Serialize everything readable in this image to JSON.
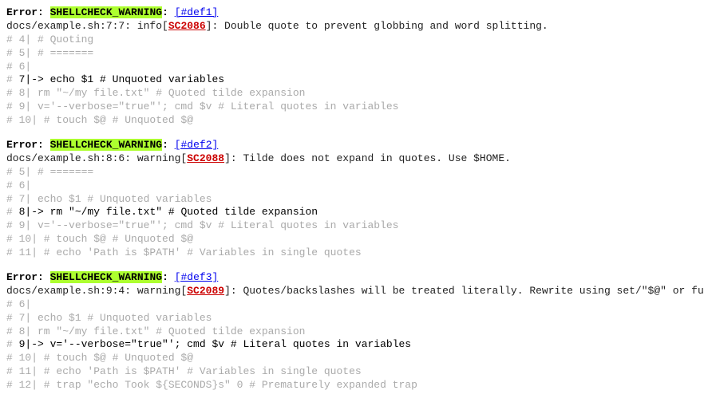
{
  "errors": [
    {
      "label": "Error:",
      "warn": "SHELLCHECK_WARNING",
      "anchor": "[#def1]",
      "loc_prefix": "docs/example.sh:7:7: info[",
      "sc": "SC2086",
      "loc_suffix": "]: Double quote to prevent globbing and word splitting.",
      "lines": [
        {
          "pre": "#    4|   # Quoting",
          "highlight": false
        },
        {
          "pre": "#    5|   # =======",
          "highlight": false
        },
        {
          "pre": "#    6|",
          "highlight": false
        },
        {
          "pre": "#    7|->  echo $1                          # Unquoted variables",
          "highlight": true
        },
        {
          "pre": "#    8|    rm \"~/my file.txt\"               # Quoted tilde expansion",
          "highlight": false
        },
        {
          "pre": "#    9|    v='--verbose=\"true\"'; cmd $v     # Literal quotes in variables",
          "highlight": false
        },
        {
          "pre": "#   10|   # touch $@                         # Unquoted $@",
          "highlight": false
        }
      ]
    },
    {
      "label": "Error:",
      "warn": "SHELLCHECK_WARNING",
      "anchor": "[#def2]",
      "loc_prefix": "docs/example.sh:8:6: warning[",
      "sc": "SC2088",
      "loc_suffix": "]: Tilde does not expand in quotes. Use $HOME.",
      "lines": [
        {
          "pre": "#    5|   # =======",
          "highlight": false
        },
        {
          "pre": "#    6|",
          "highlight": false
        },
        {
          "pre": "#    7|    echo $1                          # Unquoted variables",
          "highlight": false
        },
        {
          "pre": "#    8|->  rm \"~/my file.txt\"               # Quoted tilde expansion",
          "highlight": true
        },
        {
          "pre": "#    9|    v='--verbose=\"true\"'; cmd $v     # Literal quotes in variables",
          "highlight": false
        },
        {
          "pre": "#   10|   # touch $@                         # Unquoted $@",
          "highlight": false
        },
        {
          "pre": "#   11|   # echo 'Path is $PATH'             # Variables in single quotes",
          "highlight": false
        }
      ]
    },
    {
      "label": "Error:",
      "warn": "SHELLCHECK_WARNING",
      "anchor": "[#def3]",
      "loc_prefix": "docs/example.sh:9:4: warning[",
      "sc": "SC2089",
      "loc_suffix": "]: Quotes/backslashes will be treated literally. Rewrite using set/\"$@\" or functions.",
      "lines": [
        {
          "pre": "#    6|",
          "highlight": false
        },
        {
          "pre": "#    7|    echo $1                          # Unquoted variables",
          "highlight": false
        },
        {
          "pre": "#    8|    rm \"~/my file.txt\"               # Quoted tilde expansion",
          "highlight": false
        },
        {
          "pre": "#    9|->  v='--verbose=\"true\"'; cmd $v     # Literal quotes in variables",
          "highlight": true
        },
        {
          "pre": "#   10|   # touch $@                         # Unquoted $@",
          "highlight": false
        },
        {
          "pre": "#   11|   # echo 'Path is $PATH'             # Variables in single quotes",
          "highlight": false
        },
        {
          "pre": "#   12|   # trap \"echo Took ${SECONDS}s\" 0   # Prematurely expanded trap",
          "highlight": false
        }
      ]
    }
  ]
}
